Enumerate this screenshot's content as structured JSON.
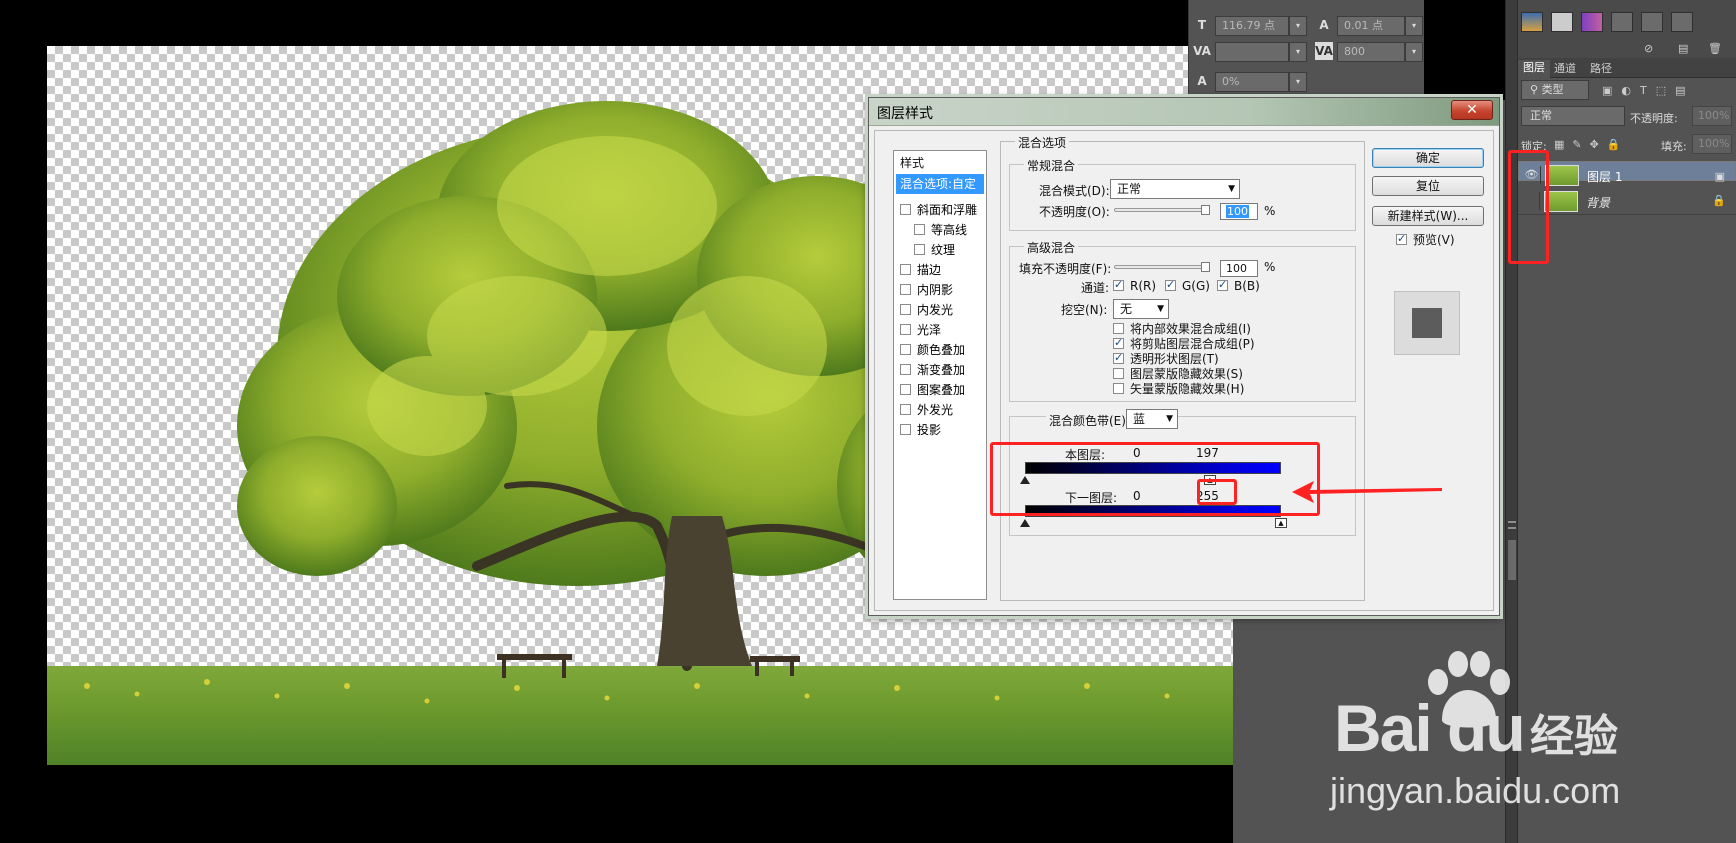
{
  "char_panel": {
    "font_size": "116.79 点",
    "leading": "0.01 点",
    "tracking": "800",
    "scale": "0%"
  },
  "layers_panel": {
    "tabs": [
      "图层",
      "通道",
      "路径"
    ],
    "filter_kind": "类型",
    "blend_mode": "正常",
    "opacity_label": "不透明度:",
    "opacity_value": "100%",
    "lock_label": "锁定:",
    "fill_label": "填充:",
    "fill_value": "100%",
    "layers": [
      {
        "name": "图层 1",
        "selected": true
      },
      {
        "name": "背景",
        "locked": true
      }
    ]
  },
  "dialog": {
    "title": "图层样式",
    "close": "✕",
    "style_list": {
      "header": "样式",
      "selected": "混合选项:自定",
      "items": [
        {
          "label": "斜面和浮雕",
          "indent": false
        },
        {
          "label": "等高线",
          "indent": true
        },
        {
          "label": "纹理",
          "indent": true
        },
        {
          "label": "描边",
          "indent": false
        },
        {
          "label": "内阴影",
          "indent": false
        },
        {
          "label": "内发光",
          "indent": false
        },
        {
          "label": "光泽",
          "indent": false
        },
        {
          "label": "颜色叠加",
          "indent": false
        },
        {
          "label": "渐变叠加",
          "indent": false
        },
        {
          "label": "图案叠加",
          "indent": false
        },
        {
          "label": "外发光",
          "indent": false
        },
        {
          "label": "投影",
          "indent": false
        }
      ]
    },
    "blend_options_title": "混合选项",
    "general_blend": {
      "title": "常规混合",
      "mode_label": "混合模式(D):",
      "mode_value": "正常",
      "opacity_label": "不透明度(O):",
      "opacity_value": "100",
      "pct": "%"
    },
    "advanced_blend": {
      "title": "高级混合",
      "fill_label": "填充不透明度(F):",
      "fill_value": "100",
      "pct": "%",
      "channels_label": "通道:",
      "channel_r": "R(R)",
      "channel_g": "G(G)",
      "channel_b": "B(B)",
      "knockout_label": "挖空(N):",
      "knockout_value": "无",
      "options": [
        {
          "label": "将内部效果混合成组(I)",
          "checked": false
        },
        {
          "label": "将剪贴图层混合成组(P)",
          "checked": true
        },
        {
          "label": "透明形状图层(T)",
          "checked": true
        },
        {
          "label": "图层蒙版隐藏效果(S)",
          "checked": false
        },
        {
          "label": "矢量蒙版隐藏效果(H)",
          "checked": false
        }
      ]
    },
    "blend_if": {
      "label": "混合颜色带(E):",
      "value": "蓝",
      "this_layer_label": "本图层:",
      "this_layer_low": "0",
      "this_layer_high": "197",
      "underlying_label": "下一图层:",
      "underlying_low": "0",
      "underlying_high": "255"
    },
    "buttons": {
      "ok": "确定",
      "reset": "复位",
      "new_style": "新建样式(W)...",
      "preview": "预览(V)"
    }
  },
  "watermark": {
    "brand": "Bai du",
    "suffix": "经验",
    "url": "jingyan.baidu.com"
  },
  "colors": {
    "annotation_red": "#ff2222",
    "selection_blue": "#3399ff",
    "panel_gray": "#535353"
  }
}
